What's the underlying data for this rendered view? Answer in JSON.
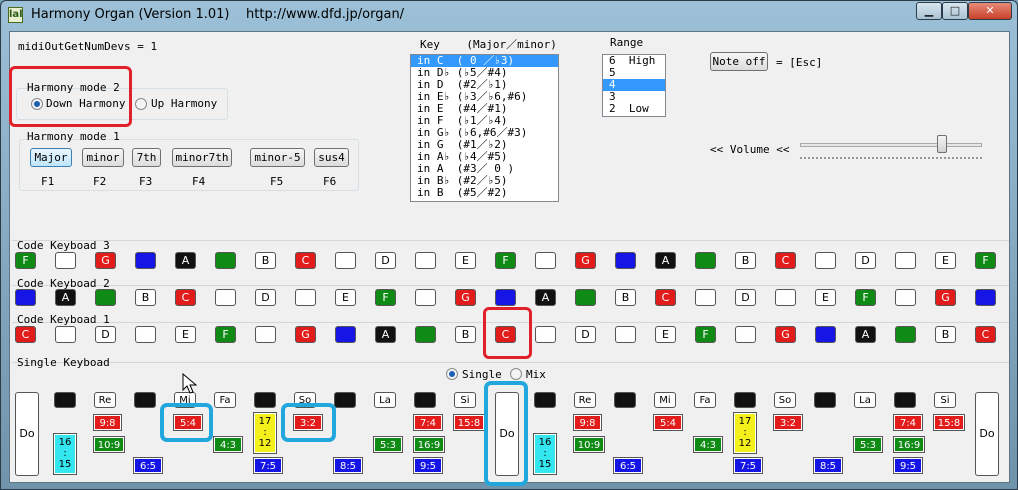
{
  "window": {
    "title": "Harmony Organ (Version 1.01)    http://www.dfd.jp/organ/",
    "icon_text": "lal",
    "minimize": "▁",
    "maximize": "□",
    "close": "✕"
  },
  "status": {
    "midi_devs": "midiOutGetNumDevs = 1"
  },
  "harmony_mode2": {
    "label": "Harmony mode 2",
    "options": [
      "Down Harmony",
      "Up Harmony"
    ],
    "selected": "Down Harmony"
  },
  "harmony_mode1": {
    "label": "Harmony mode 1",
    "buttons": [
      {
        "label": "Major",
        "key": "F1"
      },
      {
        "label": "minor",
        "key": "F2"
      },
      {
        "label": "7th",
        "key": "F3"
      },
      {
        "label": "minor7th",
        "key": "F4"
      },
      {
        "label": "minor-5",
        "key": "F5"
      },
      {
        "label": "sus4",
        "key": "F6"
      }
    ],
    "selected": "Major"
  },
  "key": {
    "label": "Key    (Major／minor)",
    "items": [
      "in C  ( 0 ／♭3)",
      "in D♭ (♭5／#4)",
      "in D  (#2／♭1)",
      "in E♭ (♭3／♭6,#6)",
      "in E  (#4／#1)",
      "in F  (♭1／♭4)",
      "in G♭ (♭6,#6／#3)",
      "in G  (#1／♭2)",
      "in A♭ (♭4／#5)",
      "in A  (#3／ 0 )",
      "in B♭ (#2／♭5)",
      "in B  (#5／#2)"
    ],
    "selected": 0
  },
  "range": {
    "label": "Range",
    "items": [
      "6  High",
      "5",
      "4",
      "3",
      "2  Low"
    ],
    "selected": 2
  },
  "note_off": {
    "label": "Note off",
    "shortcut": "= [Esc]"
  },
  "volume": {
    "label": "<< Volume <<",
    "level": 0.78
  },
  "code_keyboard3": {
    "label": "Code Keyboad 3",
    "keys": [
      [
        "F",
        "green"
      ],
      [
        "",
        ""
      ],
      [
        "G",
        "red"
      ],
      [
        "",
        "blue"
      ],
      [
        "A",
        "black"
      ],
      [
        "",
        "green"
      ],
      [
        "B",
        ""
      ],
      [
        "C",
        "red"
      ],
      [
        "",
        ""
      ],
      [
        "D",
        ""
      ],
      [
        "",
        ""
      ],
      [
        "E",
        ""
      ],
      [
        "F",
        "green"
      ],
      [
        "",
        ""
      ],
      [
        "G",
        "red"
      ],
      [
        "",
        "blue"
      ],
      [
        "A",
        "black"
      ],
      [
        "",
        "green"
      ],
      [
        "B",
        ""
      ],
      [
        "C",
        "red"
      ],
      [
        "",
        ""
      ],
      [
        "D",
        ""
      ],
      [
        "",
        ""
      ],
      [
        "E",
        ""
      ],
      [
        "F",
        "green"
      ]
    ]
  },
  "code_keyboard2": {
    "label": "Code Keyboad 2",
    "keys": [
      [
        "",
        "blue"
      ],
      [
        "A",
        "black"
      ],
      [
        "",
        "green"
      ],
      [
        "B",
        ""
      ],
      [
        "C",
        "red"
      ],
      [
        "",
        ""
      ],
      [
        "D",
        ""
      ],
      [
        "",
        ""
      ],
      [
        "E",
        ""
      ],
      [
        "F",
        "green"
      ],
      [
        "",
        ""
      ],
      [
        "G",
        "red"
      ],
      [
        "",
        "blue"
      ],
      [
        "A",
        "black"
      ],
      [
        "",
        "green"
      ],
      [
        "B",
        ""
      ],
      [
        "C",
        "red"
      ],
      [
        "",
        ""
      ],
      [
        "D",
        ""
      ],
      [
        "",
        ""
      ],
      [
        "E",
        ""
      ],
      [
        "F",
        "green"
      ],
      [
        "",
        ""
      ],
      [
        "G",
        "red"
      ],
      [
        "",
        "blue"
      ]
    ]
  },
  "code_keyboard1": {
    "label": "Code Keyboad 1",
    "keys": [
      [
        "C",
        "red"
      ],
      [
        "",
        ""
      ],
      [
        "D",
        ""
      ],
      [
        "",
        ""
      ],
      [
        "E",
        ""
      ],
      [
        "F",
        "green"
      ],
      [
        "",
        ""
      ],
      [
        "G",
        "red"
      ],
      [
        "",
        "blue"
      ],
      [
        "A",
        "black"
      ],
      [
        "",
        "green"
      ],
      [
        "B",
        ""
      ],
      [
        "C",
        "red"
      ],
      [
        "",
        ""
      ],
      [
        "D",
        ""
      ],
      [
        "",
        ""
      ],
      [
        "E",
        ""
      ],
      [
        "F",
        "green"
      ],
      [
        "",
        ""
      ],
      [
        "G",
        "red"
      ],
      [
        "",
        "blue"
      ],
      [
        "A",
        "black"
      ],
      [
        "",
        "green"
      ],
      [
        "B",
        ""
      ],
      [
        "C",
        "red"
      ]
    ]
  },
  "single_keyboard": {
    "label": "Single Keyboad",
    "modes": [
      "Single",
      "Mix"
    ],
    "selected_mode": "Single",
    "big_keys": [
      "Do",
      "Do",
      "Do"
    ],
    "white_keys": [
      "Re",
      "Mi",
      "Fa",
      "So",
      "La",
      "Si",
      "Re",
      "Mi",
      "Fa",
      "So",
      "La",
      "Si"
    ],
    "ratios": [
      {
        "text": "16\n:\n15",
        "color": "cyan"
      },
      {
        "text": "9:8",
        "color": "red"
      },
      {
        "text": "10:9",
        "color": "green"
      },
      {
        "text": "6:5",
        "color": "blue"
      },
      {
        "text": "5:4",
        "color": "red"
      },
      {
        "text": "4:3",
        "color": "green"
      },
      {
        "text": "17\n:\n12",
        "color": "yellow"
      },
      {
        "text": "7:5",
        "color": "blue"
      },
      {
        "text": "3:2",
        "color": "red"
      },
      {
        "text": "8:5",
        "color": "blue"
      },
      {
        "text": "5:3",
        "color": "green"
      },
      {
        "text": "7:4",
        "color": "red"
      },
      {
        "text": "16:9",
        "color": "green"
      },
      {
        "text": "9:5",
        "color": "blue"
      },
      {
        "text": "15:8",
        "color": "red"
      }
    ]
  },
  "colors": {
    "red": "#e21b1b",
    "green": "#0f8a14",
    "blue": "#1515e6",
    "black": "#111111",
    "cyan": "#33e6f0",
    "yellow": "#f4f01c",
    "accent": "#3399ff",
    "markup_red": "#e0202a",
    "markup_blue": "#22a7dd"
  }
}
